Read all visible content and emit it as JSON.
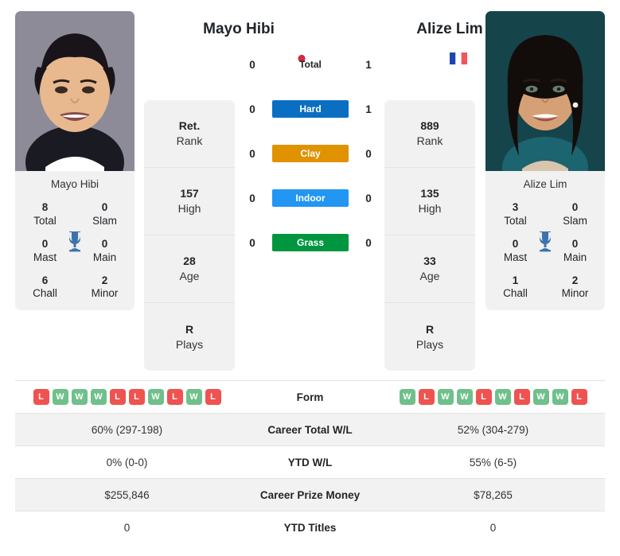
{
  "players": {
    "left": {
      "name": "Mayo Hibi",
      "card_name": "Mayo Hibi",
      "flag": "japan-flag",
      "titles": {
        "total": "8",
        "total_label": "Total",
        "slam": "0",
        "slam_label": "Slam",
        "mast": "0",
        "mast_label": "Mast",
        "main": "0",
        "main_label": "Main",
        "chall": "6",
        "chall_label": "Chall",
        "minor": "2",
        "minor_label": "Minor"
      },
      "rank": "Ret.",
      "rank_label": "Rank",
      "high": "157",
      "high_label": "High",
      "age": "28",
      "age_label": "Age",
      "plays": "R",
      "plays_label": "Plays",
      "form": [
        "L",
        "W",
        "W",
        "W",
        "L",
        "L",
        "W",
        "L",
        "W",
        "L"
      ],
      "career_wl": "60% (297-198)",
      "ytd_wl": "0% (0-0)",
      "prize_money": "$255,846",
      "ytd_titles": "0"
    },
    "right": {
      "name": "Alize Lim",
      "card_name": "Alize Lim",
      "flag": "france-flag",
      "titles": {
        "total": "3",
        "total_label": "Total",
        "slam": "0",
        "slam_label": "Slam",
        "mast": "0",
        "mast_label": "Mast",
        "main": "0",
        "main_label": "Main",
        "chall": "1",
        "chall_label": "Chall",
        "minor": "2",
        "minor_label": "Minor"
      },
      "rank": "889",
      "rank_label": "Rank",
      "high": "135",
      "high_label": "High",
      "age": "33",
      "age_label": "Age",
      "plays": "R",
      "plays_label": "Plays",
      "form": [
        "W",
        "L",
        "W",
        "W",
        "L",
        "W",
        "L",
        "W",
        "W",
        "L"
      ],
      "career_wl": "52% (304-279)",
      "ytd_wl": "55% (6-5)",
      "prize_money": "$78,265",
      "ytd_titles": "0"
    }
  },
  "h2h": {
    "rows": [
      {
        "label": "Total",
        "left": "0",
        "right": "1",
        "style": "plain",
        "color": ""
      },
      {
        "label": "Hard",
        "left": "0",
        "right": "1",
        "style": "badge",
        "color": "#0a6fc2"
      },
      {
        "label": "Clay",
        "left": "0",
        "right": "0",
        "style": "badge",
        "color": "#e09200"
      },
      {
        "label": "Indoor",
        "left": "0",
        "right": "0",
        "style": "badge",
        "color": "#2196f3"
      },
      {
        "label": "Grass",
        "left": "0",
        "right": "0",
        "style": "badge",
        "color": "#009640"
      }
    ]
  },
  "table": {
    "rows": [
      {
        "label": "Form",
        "type": "form",
        "left": "",
        "right": ""
      },
      {
        "label": "Career Total W/L",
        "type": "text",
        "left": "60% (297-198)",
        "right": "52% (304-279)"
      },
      {
        "label": "YTD W/L",
        "type": "text",
        "left": "0% (0-0)",
        "right": "55% (6-5)"
      },
      {
        "label": "Career Prize Money",
        "type": "text",
        "left": "$255,846",
        "right": "$78,265"
      },
      {
        "label": "YTD Titles",
        "type": "text",
        "left": "0",
        "right": "0"
      }
    ]
  },
  "colors": {
    "win": "#6fc08a",
    "loss": "#ef5350",
    "card_bg": "#f1f1f1",
    "trophy": "#3e72ad"
  }
}
